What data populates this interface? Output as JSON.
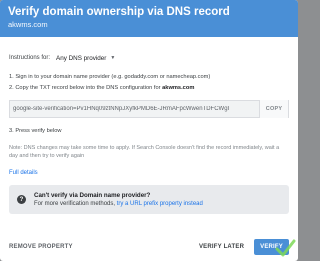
{
  "dialog": {
    "title": "Verify domain ownership via DNS record",
    "domain": "akwms.com"
  },
  "instructions": {
    "label": "Instructions for:",
    "provider_value": "Any DNS provider",
    "step1": "1. Sign in to your domain name provider (e.g. godaddy.com or namecheap.com)",
    "step2_prefix": "2. Copy the TXT record below into the DNS configuration for ",
    "step2_domain": "akwms.com",
    "txt_record": "google-site-verification=Pv1HNq09ztNNpJXyfkPMD6E-JRmAFpcWwenTDFCWgI",
    "copy_label": "COPY",
    "step3": "3. Press verify below",
    "note": "Note: DNS changes may take some time to apply. If Search Console doesn't find the record immediately, wait a day and then try to verify again",
    "full_details": "Full details"
  },
  "info_box": {
    "icon_glyph": "?",
    "title": "Can't verify via Domain name provider?",
    "body_prefix": "For more verification methods, ",
    "body_link": "try a URL prefix property instead"
  },
  "footer": {
    "remove_label": "REMOVE PROPERTY",
    "verify_later_label": "VERIFY LATER",
    "verify_label": "VERIFY"
  },
  "colors": {
    "header": "#4a8fd6",
    "link": "#1a73e8",
    "backdrop": "#8d8f91"
  }
}
